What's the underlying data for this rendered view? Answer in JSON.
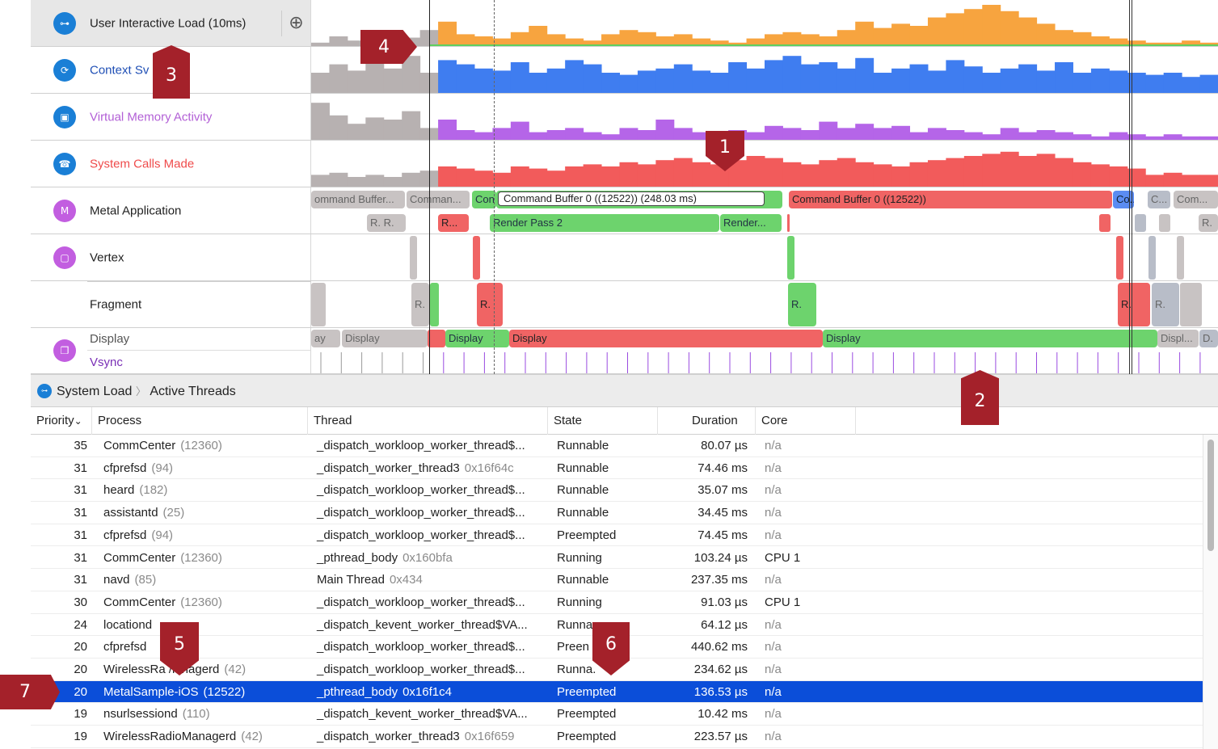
{
  "lanes": [
    {
      "name": "User Interactive Load (10ms)",
      "color": "#222",
      "icon": "load-icon",
      "icon_color": "#1a7fd6"
    },
    {
      "name": "Context Sv",
      "color": "#1f4fb5",
      "icon": "context-switch-icon",
      "icon_color": "#1a7fd6"
    },
    {
      "name": "Virtual Memory Activity",
      "color": "#b25fd6",
      "icon": "memory-icon",
      "icon_color": "#1a7fd6"
    },
    {
      "name": "System Calls Made",
      "color": "#ef4b4b",
      "icon": "syscall-icon",
      "icon_color": "#1a7fd6"
    },
    {
      "name": "Metal Application",
      "color": "#222",
      "icon": "metal-icon",
      "icon_color": "#c25ee0"
    },
    {
      "name": "Vertex",
      "color": "#222",
      "icon": "gpu-icon",
      "icon_color": "#c25ee0"
    },
    {
      "name": "Fragment",
      "color": "#222"
    },
    {
      "name": "Display",
      "color": "#555",
      "icon": "display-icon",
      "icon_color": "#c25ee0"
    },
    {
      "name": "Vsync",
      "color": "#7a2fb6"
    }
  ],
  "add_button": "⊕",
  "metal_segments_row1": [
    {
      "text": "ommand Buffer...",
      "cls": "g-gray"
    },
    {
      "text": "Comman...",
      "cls": "g-gray"
    },
    {
      "text": "Con",
      "cls": "g-green"
    },
    {
      "text": "Command Buffer 0          ((12522))  (248.03 ms)",
      "cls": "g-green"
    },
    {
      "text": "Command Buffer 0 ((12522))",
      "cls": "g-red"
    },
    {
      "text": "Co...",
      "cls": "g-blue"
    },
    {
      "text": "C...",
      "cls": "g-gray2"
    },
    {
      "text": "Com...",
      "cls": "g-gray"
    }
  ],
  "metal_segments_row2": [
    {
      "text": "R.  R.",
      "cls": "g-gray"
    },
    {
      "text": "R...",
      "cls": "g-red"
    },
    {
      "text": "Render Pass 2",
      "cls": "g-green"
    },
    {
      "text": "Render...",
      "cls": "g-green"
    },
    {
      "text": "R.",
      "cls": "g-gray"
    }
  ],
  "fragment_labels": [
    "R.",
    "R.",
    "R.",
    "R.",
    "R."
  ],
  "display_segments": [
    {
      "text": "ay",
      "cls": "g-gray"
    },
    {
      "text": "Display",
      "cls": "g-gray"
    },
    {
      "text": "Display",
      "cls": "g-green"
    },
    {
      "text": "Display",
      "cls": "g-red"
    },
    {
      "text": "Display",
      "cls": "g-green"
    },
    {
      "text": "Displ...",
      "cls": "g-gray"
    },
    {
      "text": "D.",
      "cls": "g-gray2"
    }
  ],
  "breadcrumb": {
    "root": "System Load",
    "sep": "〉",
    "leaf": "Active Threads"
  },
  "columns": [
    "Priority",
    "Process",
    "Thread",
    "State",
    "Duration",
    "Core"
  ],
  "sort_glyph": "⌄",
  "rows": [
    {
      "priority": "35",
      "process": "CommCenter",
      "pid": "(12360)",
      "thread": "_dispatch_workloop_worker_thread$...",
      "tid": "",
      "state": "Runnable",
      "duration": "80.07 µs",
      "core": "n/a"
    },
    {
      "priority": "31",
      "process": "cfprefsd",
      "pid": "(94)",
      "thread": "_dispatch_worker_thread3",
      "tid": "0x16f64c",
      "state": "Runnable",
      "duration": "74.46 ms",
      "core": "n/a"
    },
    {
      "priority": "31",
      "process": "heard",
      "pid": "(182)",
      "thread": "_dispatch_workloop_worker_thread$...",
      "tid": "",
      "state": "Runnable",
      "duration": "35.07 ms",
      "core": "n/a"
    },
    {
      "priority": "31",
      "process": "assistantd",
      "pid": "(25)",
      "thread": "_dispatch_workloop_worker_thread$...",
      "tid": "",
      "state": "Runnable",
      "duration": "34.45 ms",
      "core": "n/a"
    },
    {
      "priority": "31",
      "process": "cfprefsd",
      "pid": "(94)",
      "thread": "_dispatch_workloop_worker_thread$...",
      "tid": "",
      "state": "Preempted",
      "duration": "74.45 ms",
      "core": "n/a"
    },
    {
      "priority": "31",
      "process": "CommCenter",
      "pid": "(12360)",
      "thread": "_pthread_body",
      "tid": "0x160bfa",
      "state": "Running",
      "duration": "103.24 µs",
      "core": "CPU 1"
    },
    {
      "priority": "31",
      "process": "navd",
      "pid": "(85)",
      "thread": "Main Thread",
      "tid": "0x434",
      "state": "Runnable",
      "duration": "237.35 ms",
      "core": "n/a"
    },
    {
      "priority": "30",
      "process": "CommCenter",
      "pid": "(12360)",
      "thread": "_dispatch_workloop_worker_thread$...",
      "tid": "",
      "state": "Running",
      "duration": "91.03 µs",
      "core": "CPU 1"
    },
    {
      "priority": "24",
      "process": "locationd",
      "pid": "",
      "thread": "_dispatch_kevent_worker_thread$VA...",
      "tid": "",
      "state": "Runna",
      "duration": "64.12 µs",
      "core": "n/a"
    },
    {
      "priority": "20",
      "process": "cfprefsd",
      "pid": "",
      "thread": "_dispatch_workloop_worker_thread$...",
      "tid": "",
      "state": "Preen",
      "duration": "440.62 ms",
      "core": "n/a"
    },
    {
      "priority": "20",
      "process": "WirelessRa    /lanagerd",
      "pid": "(42)",
      "thread": "_dispatch_workloop_worker_thread$...",
      "tid": "",
      "state": "Runna.",
      "duration": "234.62 µs",
      "core": "n/a"
    },
    {
      "priority": "20",
      "process": "MetalSample-iOS",
      "pid": "(12522)",
      "thread": "_pthread_body",
      "tid": "0x16f1c4",
      "state": "Preempted",
      "duration": "136.53 µs",
      "core": "n/a",
      "selected": true
    },
    {
      "priority": "19",
      "process": "nsurlsessiond",
      "pid": "(110)",
      "thread": "_dispatch_kevent_worker_thread$VA...",
      "tid": "",
      "state": "Preempted",
      "duration": "10.42 ms",
      "core": "n/a"
    },
    {
      "priority": "19",
      "process": "WirelessRadioManagerd",
      "pid": "(42)",
      "thread": "_dispatch_worker_thread3",
      "tid": "0x16f659",
      "state": "Preempted",
      "duration": "223.57 µs",
      "core": "n/a"
    }
  ],
  "callouts": [
    "1",
    "2",
    "3",
    "4",
    "5",
    "6",
    "7"
  ],
  "colors": {
    "orange": "#f7a43f",
    "blue": "#3f7df0",
    "purple": "#b565e8",
    "red": "#f25b5b",
    "gray": "#b7b1b1",
    "green": "#5fcf5f",
    "selection": "#0b4ed9",
    "marker": "#a4212a"
  },
  "load_levels": [
    0.1,
    0.25,
    0.15,
    0.3,
    0.35,
    0.22,
    0.4,
    0.6,
    0.3,
    0.25,
    0.2,
    0.35,
    0.5,
    0.3,
    0.2,
    0.15,
    0.3,
    0.4,
    0.35,
    0.25,
    0.3,
    0.2,
    0.15,
    0.1,
    0.2,
    0.3,
    0.35,
    0.3,
    0.25,
    0.4,
    0.6,
    0.45,
    0.55,
    0.5,
    0.7,
    0.8,
    0.9,
    1.0,
    0.85,
    0.7,
    0.55,
    0.4,
    0.35,
    0.25,
    0.2,
    0.15,
    0.1,
    0.1,
    0.15,
    0.1
  ],
  "cs_levels": [
    0.5,
    0.7,
    0.55,
    0.75,
    0.6,
    0.9,
    0.5,
    0.8,
    0.7,
    0.6,
    0.55,
    0.75,
    0.5,
    0.6,
    0.8,
    0.7,
    0.5,
    0.45,
    0.55,
    0.6,
    0.7,
    0.55,
    0.5,
    0.75,
    0.6,
    0.8,
    0.9,
    0.7,
    0.75,
    0.6,
    0.85,
    0.5,
    0.6,
    0.7,
    0.55,
    0.8,
    0.65,
    0.5,
    0.6,
    0.7,
    0.55,
    0.75,
    0.5,
    0.6,
    0.55,
    0.5,
    0.45,
    0.5,
    0.4,
    0.45
  ],
  "vm_levels": [
    0.9,
    0.6,
    0.4,
    0.55,
    0.5,
    0.7,
    0.3,
    0.5,
    0.25,
    0.2,
    0.3,
    0.45,
    0.2,
    0.25,
    0.3,
    0.2,
    0.15,
    0.3,
    0.25,
    0.5,
    0.3,
    0.2,
    0.2,
    0.25,
    0.2,
    0.35,
    0.3,
    0.25,
    0.45,
    0.3,
    0.4,
    0.3,
    0.35,
    0.2,
    0.3,
    0.25,
    0.2,
    0.15,
    0.3,
    0.2,
    0.25,
    0.2,
    0.15,
    0.1,
    0.2,
    0.15,
    0.1,
    0.15,
    0.1,
    0.1
  ],
  "sys_levels": [
    0.3,
    0.35,
    0.25,
    0.3,
    0.25,
    0.35,
    0.4,
    0.5,
    0.45,
    0.4,
    0.35,
    0.5,
    0.45,
    0.4,
    0.5,
    0.55,
    0.5,
    0.6,
    0.55,
    0.65,
    0.7,
    0.6,
    0.55,
    0.65,
    0.75,
    0.7,
    0.6,
    0.55,
    0.65,
    0.7,
    0.6,
    0.55,
    0.5,
    0.6,
    0.65,
    0.7,
    0.75,
    0.8,
    0.85,
    0.75,
    0.8,
    0.7,
    0.6,
    0.55,
    0.5,
    0.45,
    0.3,
    0.35,
    0.3,
    0.3
  ]
}
